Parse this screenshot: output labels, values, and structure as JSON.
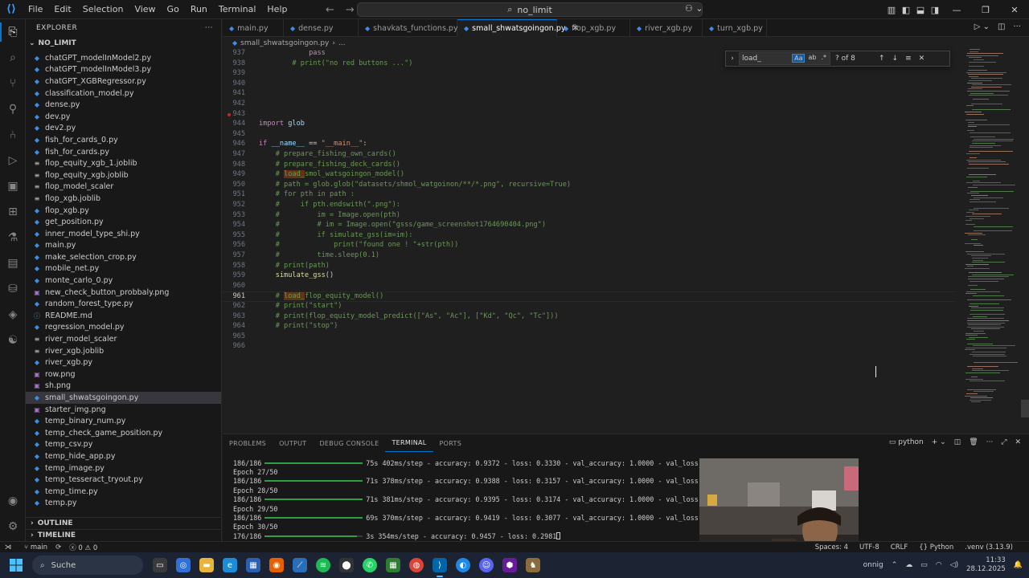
{
  "titlebar": {
    "menu": [
      "File",
      "Edit",
      "Selection",
      "View",
      "Go",
      "Run",
      "Terminal",
      "Help"
    ],
    "search": "no_limit"
  },
  "sidebar": {
    "header": "EXPLORER",
    "folder": "NO_LIMIT",
    "files": [
      {
        "name": "chatGPT_modelInModel2.py",
        "type": "py"
      },
      {
        "name": "chatGPT_modelInModel3.py",
        "type": "py"
      },
      {
        "name": "chatGPT_XGBRegressor.py",
        "type": "py"
      },
      {
        "name": "classification_model.py",
        "type": "py"
      },
      {
        "name": "dense.py",
        "type": "py"
      },
      {
        "name": "dev.py",
        "type": "py"
      },
      {
        "name": "dev2.py",
        "type": "py"
      },
      {
        "name": "fish_for_cards_0.py",
        "type": "py"
      },
      {
        "name": "fish_for_cards.py",
        "type": "py"
      },
      {
        "name": "flop_equity_xgb_1.joblib",
        "type": "job"
      },
      {
        "name": "flop_equity_xgb.joblib",
        "type": "job"
      },
      {
        "name": "flop_model_scaler",
        "type": "job"
      },
      {
        "name": "flop_xgb.joblib",
        "type": "job"
      },
      {
        "name": "flop_xgb.py",
        "type": "py"
      },
      {
        "name": "get_position.py",
        "type": "py"
      },
      {
        "name": "inner_model_type_shi.py",
        "type": "py"
      },
      {
        "name": "main.py",
        "type": "py"
      },
      {
        "name": "make_selection_crop.py",
        "type": "py"
      },
      {
        "name": "mobile_net.py",
        "type": "py"
      },
      {
        "name": "monte_carlo_0.py",
        "type": "py"
      },
      {
        "name": "new_check_button_probbaly.png",
        "type": "img"
      },
      {
        "name": "random_forest_type.py",
        "type": "py"
      },
      {
        "name": "README.md",
        "type": "md"
      },
      {
        "name": "regression_model.py",
        "type": "py"
      },
      {
        "name": "river_model_scaler",
        "type": "job"
      },
      {
        "name": "river_xgb.joblib",
        "type": "job"
      },
      {
        "name": "river_xgb.py",
        "type": "py"
      },
      {
        "name": "row.png",
        "type": "img"
      },
      {
        "name": "sh.png",
        "type": "img"
      },
      {
        "name": "small_shwatsgoingon.py",
        "type": "py",
        "selected": true
      },
      {
        "name": "starter_img.png",
        "type": "img"
      },
      {
        "name": "temp_binary_num.py",
        "type": "py"
      },
      {
        "name": "temp_check_game_position.py",
        "type": "py"
      },
      {
        "name": "temp_csv.py",
        "type": "py"
      },
      {
        "name": "temp_hide_app.py",
        "type": "py"
      },
      {
        "name": "temp_image.py",
        "type": "py"
      },
      {
        "name": "temp_tesseract_tryout.py",
        "type": "py"
      },
      {
        "name": "temp_time.py",
        "type": "py"
      },
      {
        "name": "temp.py",
        "type": "py"
      }
    ],
    "outline": "OUTLINE",
    "timeline": "TIMELINE"
  },
  "tabs": [
    {
      "label": "main.py"
    },
    {
      "label": "dense.py"
    },
    {
      "label": "shavkats_functions.py"
    },
    {
      "label": "small_shwatsgoingon.py",
      "active": true
    },
    {
      "label": "flop_xgb.py"
    },
    {
      "label": "river_xgb.py"
    },
    {
      "label": "turn_xgb.py"
    }
  ],
  "breadcrumb": {
    "file": "small_shwatsgoingon.py",
    "more": "..."
  },
  "find": {
    "query": "load_",
    "count": "? of 8",
    "opt_case": "Aa",
    "opt_word": "ab",
    "opt_regex": ".*"
  },
  "editor": {
    "lines": [
      {
        "n": "937",
        "html": "            <span class=\"k\">pass</span>"
      },
      {
        "n": "938",
        "html": "        <span class=\"c\"># print(\"no red buttons ...\")</span>"
      },
      {
        "n": "939",
        "html": ""
      },
      {
        "n": "940",
        "html": ""
      },
      {
        "n": "941",
        "html": ""
      },
      {
        "n": "942",
        "html": ""
      },
      {
        "n": "943",
        "html": ""
      },
      {
        "n": "944",
        "html": "<span class=\"k\">import</span> <span class=\"v\">glob</span>"
      },
      {
        "n": "945",
        "html": ""
      },
      {
        "n": "946",
        "html": "<span class=\"k\">if</span> <span class=\"v\">__name__</span> == <span class=\"s\">\"__main__\"</span>:"
      },
      {
        "n": "947",
        "html": "    <span class=\"c\"># prepare_fishing_own_cards()</span>"
      },
      {
        "n": "948",
        "html": "    <span class=\"c\"># prepare_fishing_deck_cards()</span>"
      },
      {
        "n": "949",
        "html": "    <span class=\"c\"># <span class=\"hl\">load_</span>smol_watsgoingon_model()</span>"
      },
      {
        "n": "950",
        "html": "    <span class=\"c\"># path = glob.glob(\"datasets/shmol_watgoinon/**/*.png\", recursive=True)</span>"
      },
      {
        "n": "951",
        "html": "    <span class=\"c\"># for pth in path :</span>"
      },
      {
        "n": "952",
        "html": "    <span class=\"c\">#     if pth.endswith(\".png\"):</span>"
      },
      {
        "n": "953",
        "html": "    <span class=\"c\">#         im = Image.open(pth)</span>"
      },
      {
        "n": "954",
        "html": "    <span class=\"c\">#         # im = Image.open(\"gsss/game_screenshot1764690404.png\")</span>"
      },
      {
        "n": "955",
        "html": "    <span class=\"c\">#         if simulate_gss(im=im):</span>"
      },
      {
        "n": "956",
        "html": "    <span class=\"c\">#             print(\"found one ! \"+str(pth))</span>"
      },
      {
        "n": "957",
        "html": "    <span class=\"c\">#         time.sleep(0.1)</span>"
      },
      {
        "n": "958",
        "html": "    <span class=\"c\"># print(path)</span>"
      },
      {
        "n": "959",
        "html": "    <span class=\"f\">simulate_gss</span>()"
      },
      {
        "n": "960",
        "html": ""
      },
      {
        "n": "961",
        "html": "    <span class=\"c\"># <span class=\"hl\">load_</span>flop_equity_model()</span>",
        "current": true
      },
      {
        "n": "962",
        "html": "    <span class=\"c\"># print(\"start\")</span>"
      },
      {
        "n": "963",
        "html": "    <span class=\"c\"># print(flop_equity_model_predict([\"As\", \"Ac\"], [\"Kd\", \"Qc\", \"Tc\"]))</span>"
      },
      {
        "n": "964",
        "html": "    <span class=\"c\"># print(\"stop\")</span>"
      },
      {
        "n": "965",
        "html": ""
      },
      {
        "n": "966",
        "html": ""
      }
    ]
  },
  "panel": {
    "tabs": [
      "PROBLEMS",
      "OUTPUT",
      "DEBUG CONSOLE",
      "TERMINAL",
      "PORTS"
    ],
    "active_tab": "TERMINAL",
    "shell": "python",
    "terminal": [
      {
        "steps": "186/186",
        "progress": 1.0,
        "text": "75s 402ms/step - accuracy: 0.9372 - loss: 0.3330 - val_accuracy: 1.0000 - val_loss: 0.0846"
      },
      {
        "text": "Epoch 27/50"
      },
      {
        "steps": "186/186",
        "progress": 1.0,
        "text": "71s 378ms/step - accuracy: 0.9388 - loss: 0.3157 - val_accuracy: 1.0000 - val_loss: 0.0829"
      },
      {
        "text": "Epoch 28/50"
      },
      {
        "steps": "186/186",
        "progress": 1.0,
        "text": "71s 381ms/step - accuracy: 0.9395 - loss: 0.3174 - val_accuracy: 1.0000 - val_loss: 0.0825"
      },
      {
        "text": "Epoch 29/50"
      },
      {
        "steps": "186/186",
        "progress": 1.0,
        "text": "69s 370ms/step - accuracy: 0.9419 - loss: 0.3077 - val_accuracy: 1.0000 - val_loss: 0.0832"
      },
      {
        "text": "Epoch 30/50"
      },
      {
        "steps": "176/186",
        "progress": 0.946,
        "text": "3s 354ms/step - accuracy: 0.9457 - loss: 0.2981",
        "cursor": true
      }
    ]
  },
  "statusbar": {
    "branch": "main",
    "errors": "0",
    "warnings": "0",
    "spaces": "Spaces: 4",
    "encoding": "UTF-8",
    "eol": "CRLF",
    "language": "Python",
    "interpreter": ".venv (3.13.9)"
  },
  "taskbar": {
    "search": "Suche",
    "time": "11:33",
    "date": "28.12.2025",
    "tray_text": "onnig"
  }
}
